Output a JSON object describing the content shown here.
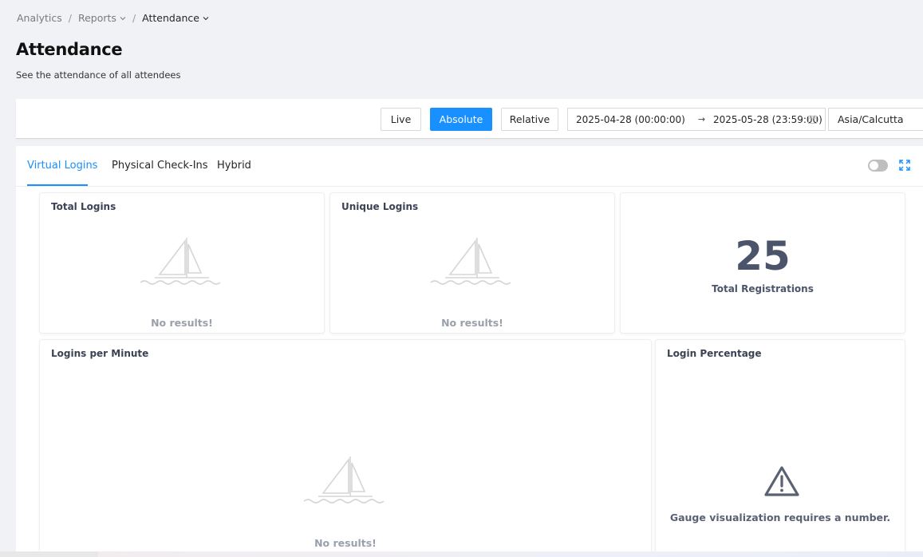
{
  "breadcrumb": [
    {
      "label": "Analytics",
      "has_dropdown": false
    },
    {
      "label": "Reports",
      "has_dropdown": true
    },
    {
      "label": "Attendance",
      "has_dropdown": true
    }
  ],
  "page": {
    "title": "Attendance",
    "subtitle": "See the attendance of all attendees"
  },
  "toolbar": {
    "live_label": "Live",
    "absolute_label": "Absolute",
    "relative_label": "Relative",
    "active_mode": "Absolute",
    "range_start": "2025-04-28 (00:00:00)",
    "range_arrow": "→",
    "range_end": "2025-05-28 (23:59:00)",
    "timezone": "Asia/Calcutta"
  },
  "tabs": [
    {
      "label": "Virtual Logins",
      "active": true
    },
    {
      "label": "Physical Check-Ins",
      "active": false
    },
    {
      "label": "Hybrid",
      "active": false
    }
  ],
  "cards": {
    "total_logins": {
      "title": "Total Logins",
      "empty_text": "No results!"
    },
    "unique_logins": {
      "title": "Unique Logins",
      "empty_text": "No results!"
    },
    "total_registrations": {
      "value": "25",
      "label": "Total Registrations"
    },
    "logins_per_minute": {
      "title": "Logins per Minute",
      "empty_text": "No results!"
    },
    "login_percentage": {
      "title": "Login Percentage",
      "message": "Gauge visualization requires a number."
    }
  },
  "colors": {
    "accent": "#1890ff",
    "metric_text": "#4b546a",
    "empty_text": "#9aa0aa"
  },
  "icons": {
    "empty_state": "sailboat-icon",
    "warning": "warning-triangle-icon",
    "expand": "expand-icon",
    "calendar": "calendar-icon"
  }
}
